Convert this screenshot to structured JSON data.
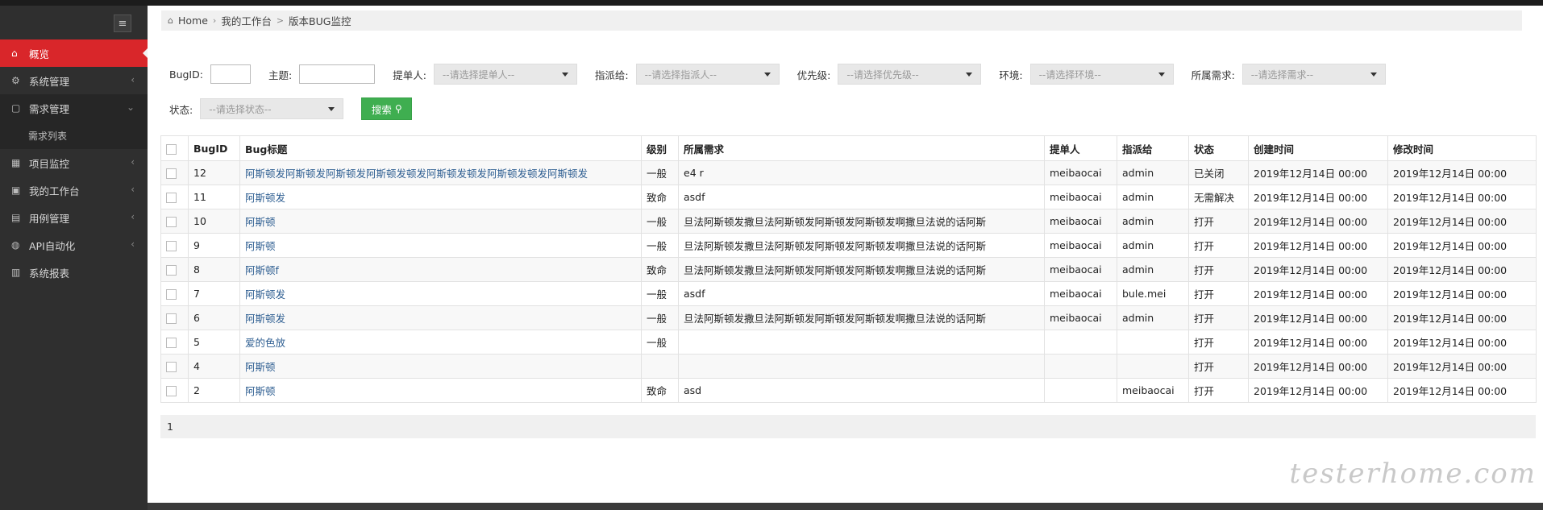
{
  "sidebar": {
    "toggle_icon": "≡",
    "items": [
      {
        "icon": "⌂",
        "label": "概览",
        "arrow": ""
      },
      {
        "icon": "⚙",
        "label": "系统管理",
        "arrow": "‹"
      },
      {
        "icon": "▢",
        "label": "需求管理",
        "arrow": "⌄"
      },
      {
        "icon": "▦",
        "label": "项目监控",
        "arrow": "‹"
      },
      {
        "icon": "▣",
        "label": "我的工作台",
        "arrow": "‹"
      },
      {
        "icon": "▤",
        "label": "用例管理",
        "arrow": "‹"
      },
      {
        "icon": "◍",
        "label": "API自动化",
        "arrow": "‹"
      },
      {
        "icon": "▥",
        "label": "系统报表",
        "arrow": ""
      }
    ],
    "sub_item": "需求列表"
  },
  "breadcrumb": {
    "home": "Home",
    "sep1": "›",
    "mid": "我的工作台",
    "sep2": ">",
    "current": "版本BUG监控"
  },
  "filters": {
    "bugid_label": "BugID:",
    "title_label": "主题:",
    "reporter_label": "提单人:",
    "reporter_placeholder": "--请选择提单人--",
    "assignee_label": "指派给:",
    "assignee_placeholder": "--请选择指派人--",
    "priority_label": "优先级:",
    "priority_placeholder": "--请选择优先级--",
    "env_label": "环境:",
    "env_placeholder": "--请选择环境--",
    "req_label": "所属需求:",
    "req_placeholder": "--请选择需求--",
    "status_label": "状态:",
    "status_placeholder": "--请选择状态--",
    "search_label": "搜索"
  },
  "table": {
    "headers": [
      "BugID",
      "Bug标题",
      "级别",
      "所属需求",
      "提单人",
      "指派给",
      "状态",
      "创建时间",
      "修改时间"
    ],
    "rows": [
      [
        "12",
        "阿斯顿发阿斯顿发阿斯顿发阿斯顿发顿发阿斯顿发顿发阿斯顿发顿发阿斯顿发",
        "一般",
        "e4 r",
        "meibaocai",
        "admin",
        "已关闭",
        "2019年12月14日 00:00",
        "2019年12月14日 00:00"
      ],
      [
        "11",
        "阿斯顿发",
        "致命",
        "asdf",
        "meibaocai",
        "admin",
        "无需解决",
        "2019年12月14日 00:00",
        "2019年12月14日 00:00"
      ],
      [
        "10",
        "阿斯顿",
        "一般",
        "旦法阿斯顿发撒旦法阿斯顿发阿斯顿发阿斯顿发啊撒旦法说的话阿斯",
        "meibaocai",
        "admin",
        "打开",
        "2019年12月14日 00:00",
        "2019年12月14日 00:00"
      ],
      [
        "9",
        "阿斯顿",
        "一般",
        "旦法阿斯顿发撒旦法阿斯顿发阿斯顿发阿斯顿发啊撒旦法说的话阿斯",
        "meibaocai",
        "admin",
        "打开",
        "2019年12月14日 00:00",
        "2019年12月14日 00:00"
      ],
      [
        "8",
        "阿斯顿f",
        "致命",
        "旦法阿斯顿发撒旦法阿斯顿发阿斯顿发阿斯顿发啊撒旦法说的话阿斯",
        "meibaocai",
        "admin",
        "打开",
        "2019年12月14日 00:00",
        "2019年12月14日 00:00"
      ],
      [
        "7",
        "阿斯顿发",
        "一般",
        "asdf",
        "meibaocai",
        "bule.mei",
        "打开",
        "2019年12月14日 00:00",
        "2019年12月14日 00:00"
      ],
      [
        "6",
        "阿斯顿发",
        "一般",
        "旦法阿斯顿发撒旦法阿斯顿发阿斯顿发阿斯顿发啊撒旦法说的话阿斯",
        "meibaocai",
        "admin",
        "打开",
        "2019年12月14日 00:00",
        "2019年12月14日 00:00"
      ],
      [
        "5",
        "爱的色放",
        "一般",
        "",
        "",
        "",
        "打开",
        "2019年12月14日 00:00",
        "2019年12月14日 00:00"
      ],
      [
        "4",
        "阿斯顿",
        "",
        "",
        "",
        "",
        "打开",
        "2019年12月14日 00:00",
        "2019年12月14日 00:00"
      ],
      [
        "2",
        "阿斯顿",
        "致命",
        "asd",
        "",
        "meibaocai",
        "打开",
        "2019年12月14日 00:00",
        "2019年12月14日 00:00"
      ]
    ]
  },
  "pager": {
    "page": "1"
  },
  "watermark": "testerhome.com"
}
